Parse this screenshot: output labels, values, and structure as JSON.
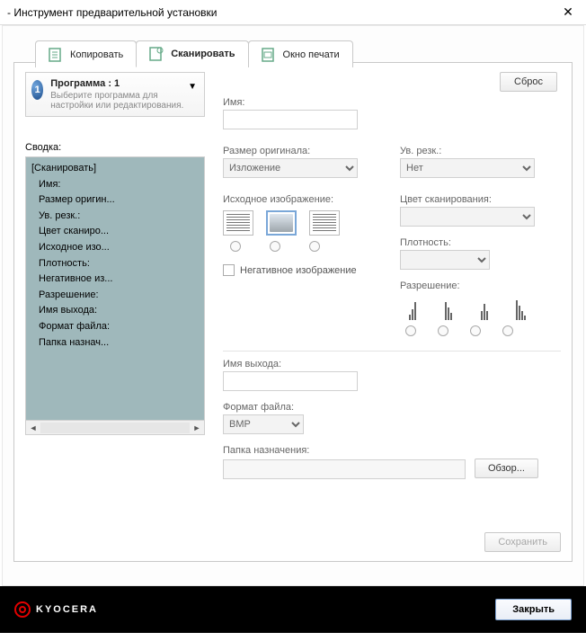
{
  "window": {
    "title": "- Инструмент предварительной установки"
  },
  "tabs": {
    "copy": "Копировать",
    "scan": "Сканировать",
    "print": "Окно печати"
  },
  "program": {
    "num": "1",
    "title": "Программа : 1",
    "hint": "Выберите программа для настройки или редактирования."
  },
  "summary": {
    "label": "Сводка:",
    "head": "[Сканировать]",
    "items": [
      "Имя:",
      "Размер оригин...",
      "Ув. резк.:",
      "Цвет сканиро...",
      "Исходное изо...",
      "Плотность:",
      "Негативное из...",
      "Разрешение:",
      "Имя выхода:",
      "Формат файла:",
      "Папка назнач..."
    ]
  },
  "buttons": {
    "reset": "Сброс",
    "browse": "Обзор...",
    "save": "Сохранить",
    "close": "Закрыть"
  },
  "labels": {
    "name": "Имя:",
    "orig_size": "Размер оригинала:",
    "sharpen": "Ув. резк.:",
    "src_image": "Исходное изображение:",
    "scan_color": "Цвет сканирования:",
    "density": "Плотность:",
    "negative": "Негативное изображение",
    "resolution": "Разрешение:",
    "out_name": "Имя выхода:",
    "file_format": "Формат файла:",
    "dest_folder": "Папка назначения:"
  },
  "values": {
    "orig_size": "Изложение",
    "sharpen": "Нет",
    "file_format": "BMP"
  },
  "brand": "KYOCERA"
}
